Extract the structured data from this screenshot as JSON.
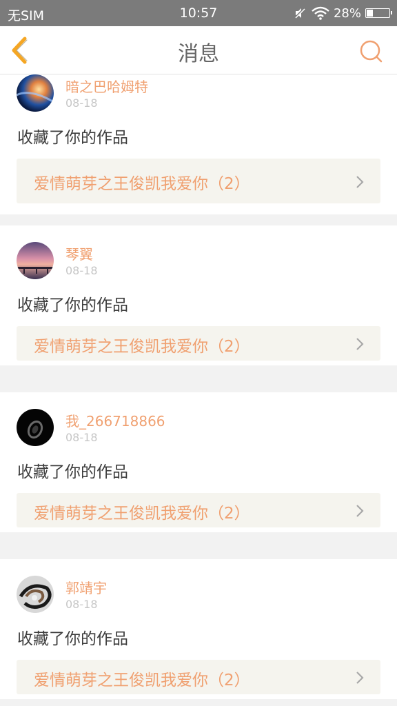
{
  "status_bar": {
    "carrier": "无SIM",
    "time": "10:57",
    "battery_percent": "28%",
    "battery_level": 0.28
  },
  "nav": {
    "title": "消息",
    "back_icon": "chevron-left-icon",
    "search_icon": "search-icon",
    "accent_color": "#f5a623"
  },
  "colors": {
    "username": "#f0a070",
    "link_bg": "#f5f4ee",
    "divider_bg": "#f2f2f2"
  },
  "messages": [
    {
      "user": "暗之巴哈姆特",
      "date": "08-18",
      "action": "收藏了你的作品",
      "work": "爱情萌芽之王俊凯我爱你（2）"
    },
    {
      "user": "琴翼",
      "date": "08-18",
      "action": "收藏了你的作品",
      "work": "爱情萌芽之王俊凯我爱你（2）"
    },
    {
      "user": "我_266718866",
      "date": "08-18",
      "action": "收藏了你的作品",
      "work": "爱情萌芽之王俊凯我爱你（2）"
    },
    {
      "user": "郭靖宇",
      "date": "08-18",
      "action": "收藏了你的作品",
      "work": "爱情萌芽之王俊凯我爱你（2）"
    }
  ]
}
